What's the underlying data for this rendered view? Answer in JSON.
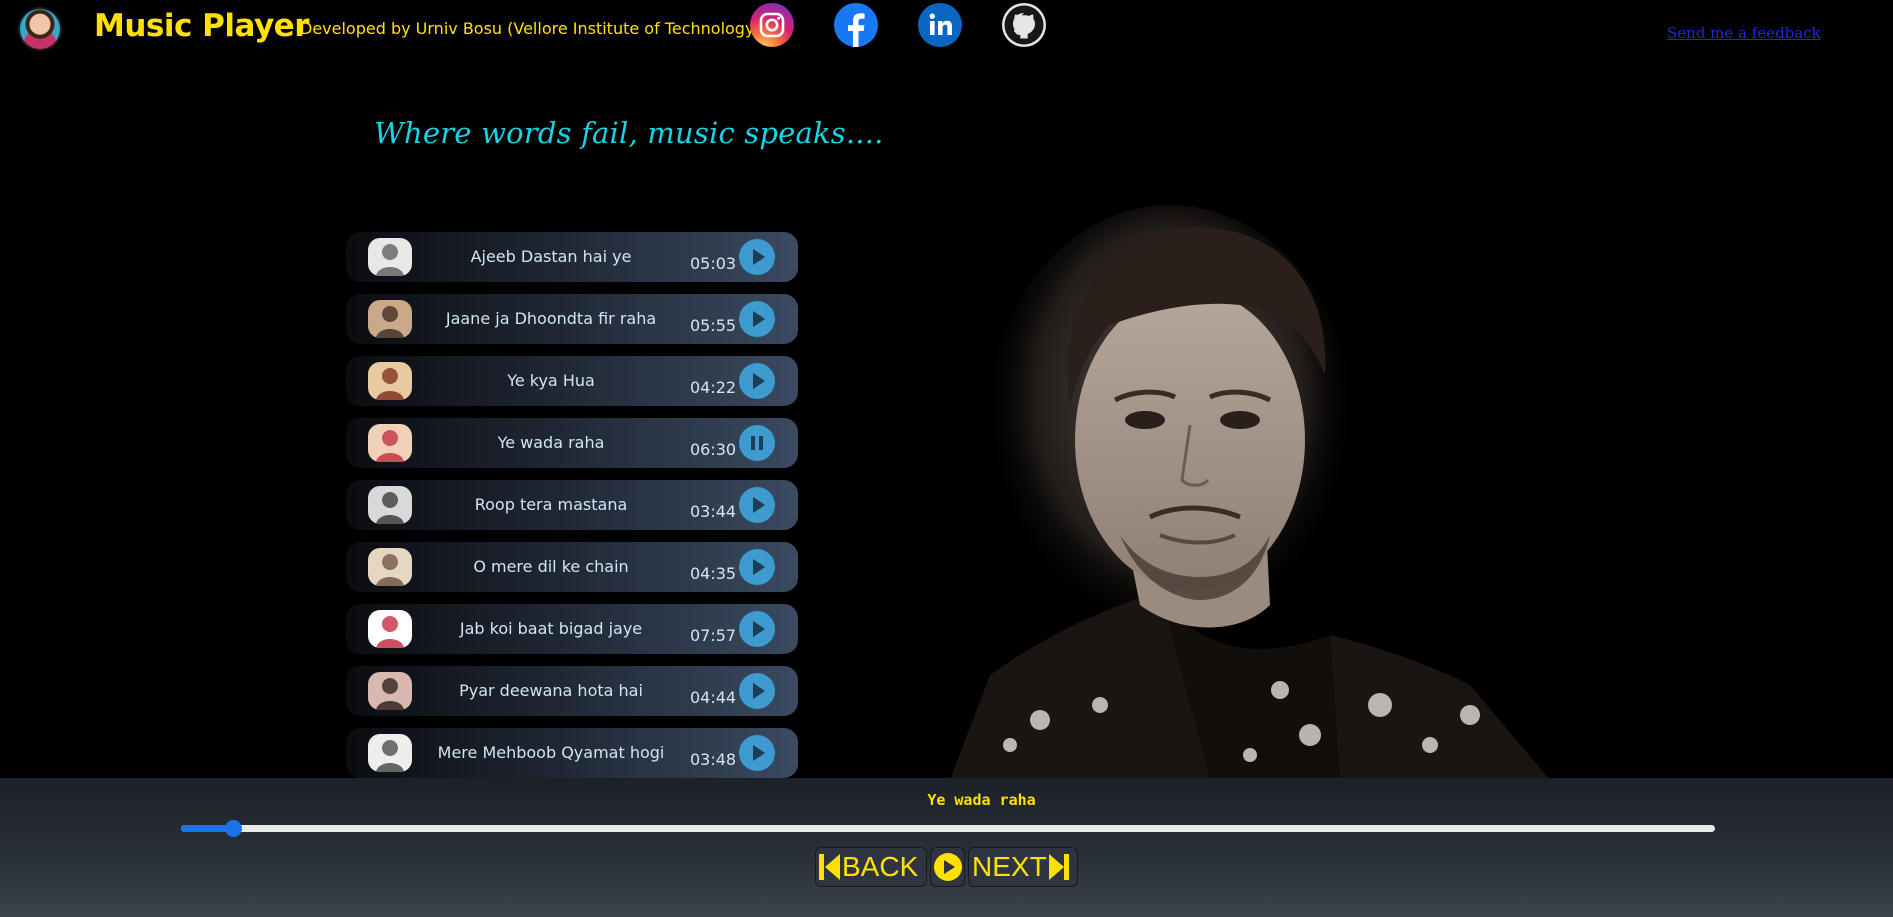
{
  "header": {
    "title": "Music Player",
    "developer": "Developed by Urniv Bosu (Vellore Institute of Technology)",
    "social": [
      "instagram-icon",
      "facebook-icon",
      "linkedin-icon",
      "github-icon"
    ],
    "feedback_link": "Send me a feedback"
  },
  "quote": "Where words fail, music speaks....",
  "songs": [
    {
      "title": "Ajeeb Dastan hai ye",
      "duration": "05:03",
      "state": "play"
    },
    {
      "title": "Jaane ja Dhoondta fir raha",
      "duration": "05:55",
      "state": "play"
    },
    {
      "title": "Ye kya Hua",
      "duration": "04:22",
      "state": "play"
    },
    {
      "title": "Ye wada raha",
      "duration": "06:30",
      "state": "pause"
    },
    {
      "title": "Roop tera mastana",
      "duration": "03:44",
      "state": "play"
    },
    {
      "title": "O mere dil ke chain",
      "duration": "04:35",
      "state": "play"
    },
    {
      "title": "Jab koi baat bigad jaye",
      "duration": "07:57",
      "state": "play"
    },
    {
      "title": "Pyar deewana hota hai",
      "duration": "04:44",
      "state": "play"
    },
    {
      "title": "Mere Mehboob Qyamat hogi",
      "duration": "03:48",
      "state": "play"
    }
  ],
  "player": {
    "now_playing": "Ye wada raha",
    "progress": 0.034,
    "back_label": "BACK",
    "next_label": "NEXT"
  },
  "colors": {
    "accent_yellow": "#ffe100",
    "quote_cyan": "#18d4e6",
    "play_blue": "#3d9bd0",
    "progress_blue": "#1a73e8"
  }
}
